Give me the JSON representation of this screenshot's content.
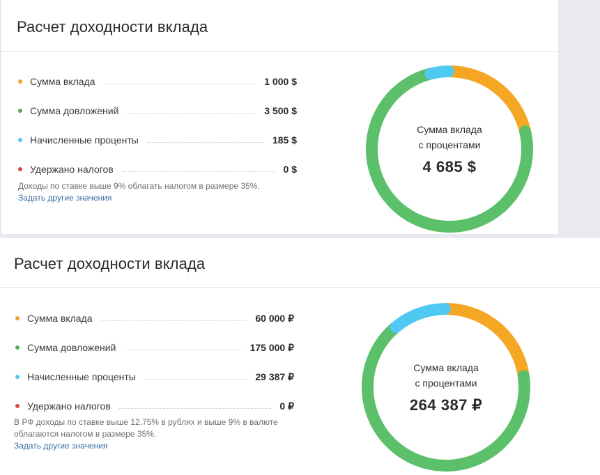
{
  "colors": {
    "deposit": "#f5a623",
    "additions": "#5cc06a",
    "interest": "#4fc8f2",
    "taxes": "#e14a3b"
  },
  "cards": [
    {
      "title": "Расчет доходности вклада",
      "rows": [
        {
          "label": "Сумма вклада",
          "value": "1 000 $",
          "color": "#f0a030"
        },
        {
          "label": "Сумма довложений",
          "value": "3 500 $",
          "color": "#4caf50"
        },
        {
          "label": "Начисленные проценты",
          "value": "185 $",
          "color": "#4fc8f2"
        },
        {
          "label": "Удержано налогов",
          "value": "0 $",
          "color": "#e14a3b"
        }
      ],
      "note": "Доходы по ставке выше 9% облагать налогом в размере 35%.",
      "link": "Задать другие значения",
      "ring": {
        "caption_line1": "Сумма вклада",
        "caption_line2": "с процентами",
        "total": "4 685 $",
        "segments": [
          {
            "name": "deposit",
            "value": 1000
          },
          {
            "name": "additions",
            "value": 3500
          },
          {
            "name": "interest",
            "value": 185
          }
        ]
      }
    },
    {
      "title": "Расчет доходности вклада",
      "rows": [
        {
          "label": "Сумма вклада",
          "value": "60 000 ₽",
          "color": "#f0a030"
        },
        {
          "label": "Сумма довложений",
          "value": "175 000 ₽",
          "color": "#4caf50"
        },
        {
          "label": "Начисленные проценты",
          "value": "29 387 ₽",
          "color": "#4fc8f2"
        },
        {
          "label": "Удержано налогов",
          "value": "0 ₽",
          "color": "#e14a3b"
        }
      ],
      "note": "В РФ доходы по ставке выше 12.75% в рублях и выше 9% в валюте облагаются налогом в размере 35%.",
      "link": "Задать другие значения",
      "ring": {
        "caption_line1": "Сумма вклада",
        "caption_line2": "с процентами",
        "total": "264 387 ₽",
        "segments": [
          {
            "name": "deposit",
            "value": 60000
          },
          {
            "name": "additions",
            "value": 175000
          },
          {
            "name": "interest",
            "value": 29387
          }
        ]
      }
    }
  ]
}
